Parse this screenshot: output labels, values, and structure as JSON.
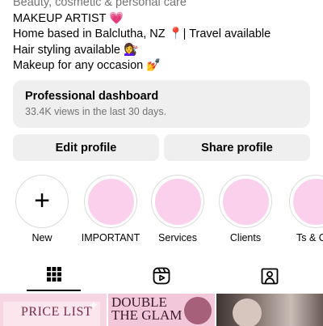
{
  "profile": {
    "category": "Beauty, cosmetic & personal care",
    "bio_line1": "MAKEUP ARTIST 💗",
    "bio_line2": "Home based in Balclutha, NZ 📍| Travel available",
    "bio_line3": "Hair styling available 💇‍♀️",
    "bio_line4": "Makeup for any occasion 💅"
  },
  "dashboard": {
    "title": "Professional dashboard",
    "subtitle": "33.4K views in the last 30 days."
  },
  "actions": {
    "edit_label": "Edit profile",
    "share_label": "Share profile"
  },
  "highlights": [
    {
      "label": "New",
      "icon": "plus-icon"
    },
    {
      "label": "IMPORTANT"
    },
    {
      "label": "Services"
    },
    {
      "label": "Clients"
    },
    {
      "label": "Ts & C"
    }
  ],
  "tabs": [
    {
      "name": "grid",
      "icon": "grid-icon",
      "active": true
    },
    {
      "name": "reels",
      "icon": "reels-icon"
    },
    {
      "name": "tagged",
      "icon": "tagged-icon"
    }
  ],
  "posts": [
    {
      "text": "PRICE LIST"
    },
    {
      "text_line1": "DOUBLE",
      "text_line2": "THE GLAM"
    },
    {
      "text": ""
    }
  ],
  "colors": {
    "highlight_fill": "#fbd0ec",
    "button_bg": "#efefef",
    "secondary_text": "#737373"
  }
}
